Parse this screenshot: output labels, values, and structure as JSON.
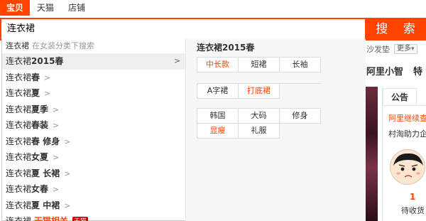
{
  "tabs": [
    "宝贝",
    "天猫",
    "店铺"
  ],
  "search": {
    "query": "连衣裙",
    "button_label": "搜 索"
  },
  "dropdown": {
    "hint_query": "连衣裙",
    "hint_scope": "在女装分类下搜索",
    "suggestions": [
      {
        "base": "连衣裙",
        "suffix": "2015春",
        "active": true
      },
      {
        "base": "连衣裙",
        "suffix": "春"
      },
      {
        "base": "连衣裙",
        "suffix": "夏"
      },
      {
        "base": "连衣裙",
        "suffix": "夏季"
      },
      {
        "base": "连衣裙",
        "suffix": "春装"
      },
      {
        "base": "连衣裙",
        "suffix": "春 修身"
      },
      {
        "base": "连衣裙",
        "suffix": "女夏"
      },
      {
        "base": "连衣裙",
        "suffix": "夏 长裙"
      },
      {
        "base": "连衣裙",
        "suffix": "女春"
      },
      {
        "base": "连衣裙",
        "suffix": "夏 中裙"
      }
    ],
    "tmall": {
      "base": "连衣裙",
      "related": "天猫相关",
      "badge": "天猫"
    },
    "right": {
      "title": "连衣裙2015春",
      "groups": [
        [
          {
            "label": "中长款",
            "hl": true
          },
          {
            "label": "短裙"
          },
          {
            "label": "长袖"
          }
        ],
        [
          {
            "label": "A字裙"
          },
          {
            "label": "打底裙",
            "hl": true
          }
        ],
        [
          {
            "label": "韩国"
          },
          {
            "label": "大码"
          },
          {
            "label": "修身"
          },
          {
            "label": "显瘦",
            "hl": true
          },
          {
            "label": "礼服"
          }
        ]
      ]
    }
  },
  "background": {
    "hotword": "沙发垫",
    "more_label": "更多",
    "nav": [
      "阿里小智",
      "特"
    ],
    "notice_tab": "公告",
    "notice_link": "阿里继续查",
    "notice_text": "村淘助力企",
    "pending_count": "1",
    "pending_label": "待收货"
  },
  "colors": {
    "accent": "#ff4400",
    "tmall_badge": "#c40000"
  }
}
